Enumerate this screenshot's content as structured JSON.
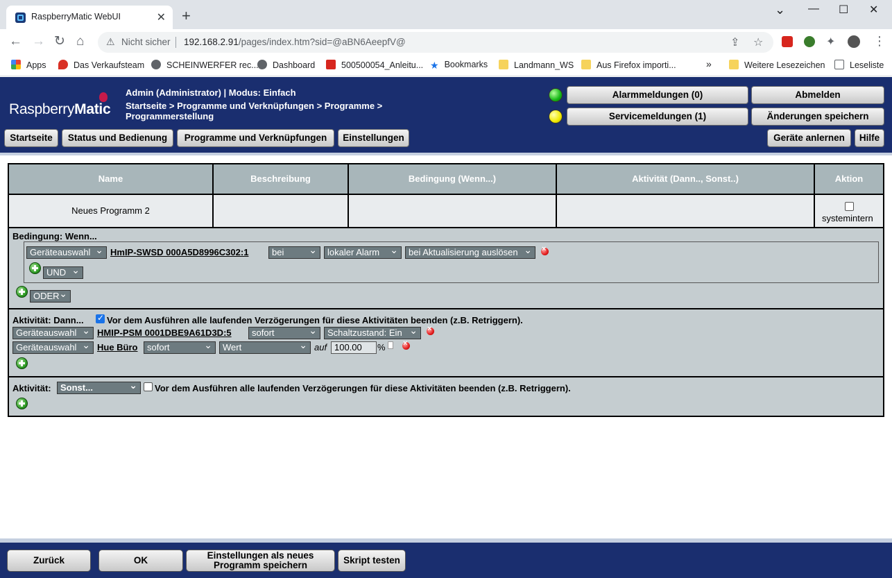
{
  "browser": {
    "tab_title": "RaspberryMatic WebUI",
    "tab_close": "✕",
    "new_tab": "+",
    "minimize": "⌄",
    "maximize": "—",
    "restore": "☐",
    "close": "✕",
    "not_secure": "Nicht sicher",
    "url_host": "192.168.2.91",
    "url_path": "/pages/index.htm?sid=@aBN6AeepfV@",
    "bookmarks": [
      "Apps",
      "Das Verkaufsteam",
      "SCHEINWERFER rec...",
      "Dashboard",
      "500500054_Anleitu...",
      "Bookmarks",
      "Landmann_WS",
      "Aus Firefox importi..."
    ],
    "more_bookmarks": "»",
    "other_bookmarks": "Weitere Lesezeichen",
    "reading_list": "Leseliste"
  },
  "header": {
    "logo_light": "Raspberry",
    "logo_bold": "Matic",
    "user": "Admin (Administrator) | Modus: Einfach",
    "breadcrumb": "Startseite > Programme und Verknüpfungen > Programme > Programmerstellung",
    "alarm_button": "Alarmmeldungen (0)",
    "service_button": "Servicemeldungen (1)",
    "logout_button": "Abmelden",
    "save_changes_button": "Änderungen speichern",
    "alarm_led_color": "#15b815",
    "service_led_color": "#f1e900"
  },
  "nav": {
    "home": "Startseite",
    "status": "Status und Bedienung",
    "programs": "Programme und Verknüpfungen",
    "settings": "Einstellungen",
    "teach": "Geräte anlernen",
    "help": "Hilfe"
  },
  "table": {
    "headers": [
      "Name",
      "Beschreibung",
      "Bedingung (Wenn...)",
      "Aktivität (Dann.., Sonst..)",
      "Aktion"
    ],
    "program_name": "Neues Programm 2",
    "system_internal": "systemintern",
    "system_internal_checked": false
  },
  "condition": {
    "title": "Bedingung: Wenn...",
    "device_select": "Geräteauswahl",
    "device_name": "HmIP-SWSD 000A5D8996C302:1",
    "op_select": "bei",
    "param_select": "lokaler Alarm",
    "trigger_select": "bei Aktualisierung auslösen",
    "and_select": "UND",
    "or_select": "ODER"
  },
  "then": {
    "title": "Aktivität: Dann...",
    "retrigger_checked": true,
    "retrigger_text": "Vor dem Ausführen alle laufenden Verzögerungen für diese Aktivitäten beenden (z.B. Retriggern).",
    "rows": [
      {
        "device_select": "Geräteauswahl",
        "device_name": "HMIP-PSM 0001DBE9A61D3D:5",
        "timing_select": "sofort",
        "value_select": "Schaltzustand: Ein"
      },
      {
        "device_select": "Geräteauswahl",
        "device_name": "Hue Büro",
        "timing_select": "sofort",
        "value_select": "Wert",
        "auf_label": "auf",
        "value_input": "100.00",
        "unit": "%"
      }
    ]
  },
  "else": {
    "title": "Aktivität:",
    "else_select": "Sonst...",
    "retrigger_checked": false,
    "retrigger_text": "Vor dem Ausführen alle laufenden Verzögerungen für diese Aktivitäten beenden (z.B. Retriggern)."
  },
  "footer": {
    "back": "Zurück",
    "ok": "OK",
    "save_as_new": "Einstellungen als neues Programm speichern",
    "test_script": "Skript testen"
  }
}
